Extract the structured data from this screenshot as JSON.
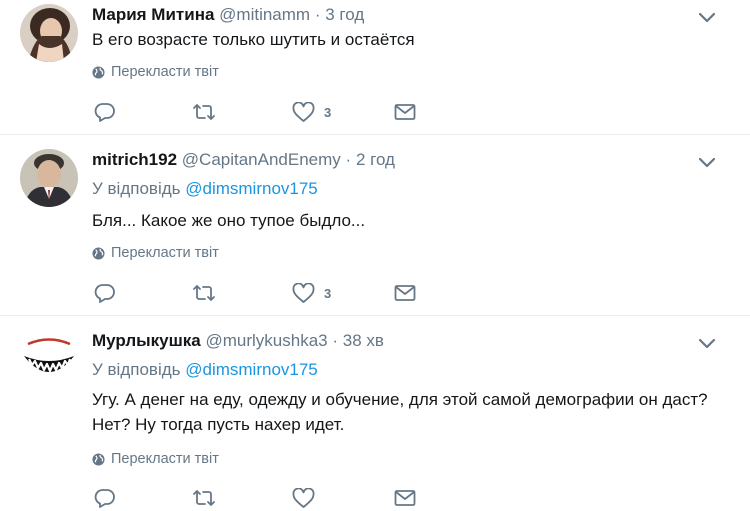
{
  "translate_label": "Перекласти твіт",
  "reply_prefix": "У відповідь",
  "tweets": [
    {
      "name": "Мария Митина",
      "handle": "@mitinamm",
      "separator": "·",
      "time": "3 год",
      "reply_to": "",
      "text": "В его возрасте только шутить и остаётся",
      "likes": "3"
    },
    {
      "name": "mitrich192",
      "handle": "@CapitanAndEnemy",
      "separator": "·",
      "time": "2 год",
      "reply_to": "@dimsmirnov175",
      "text": "Бля... Какое же оно тупое быдло...",
      "likes": "3"
    },
    {
      "name": "Мурлыкушка",
      "handle": "@murlykushka3",
      "separator": "·",
      "time": "38 хв",
      "reply_to": "@dimsmirnov175",
      "text_line1": "Угу. А денег на еду, одежду и обучение, для этой самой демографии он даст?",
      "text_line2": "Нет? Ну тогда пусть нахер идет.",
      "likes": ""
    }
  ],
  "icons": {
    "reply": "reply-icon",
    "retweet": "retweet-icon",
    "like": "heart-icon",
    "dm": "envelope-icon",
    "globe": "globe-icon",
    "chevron": "chevron-down-icon"
  },
  "colors": {
    "name": "#14171a",
    "secondary": "#657786",
    "link": "#1b95e0",
    "divider": "#e6ecf0"
  }
}
